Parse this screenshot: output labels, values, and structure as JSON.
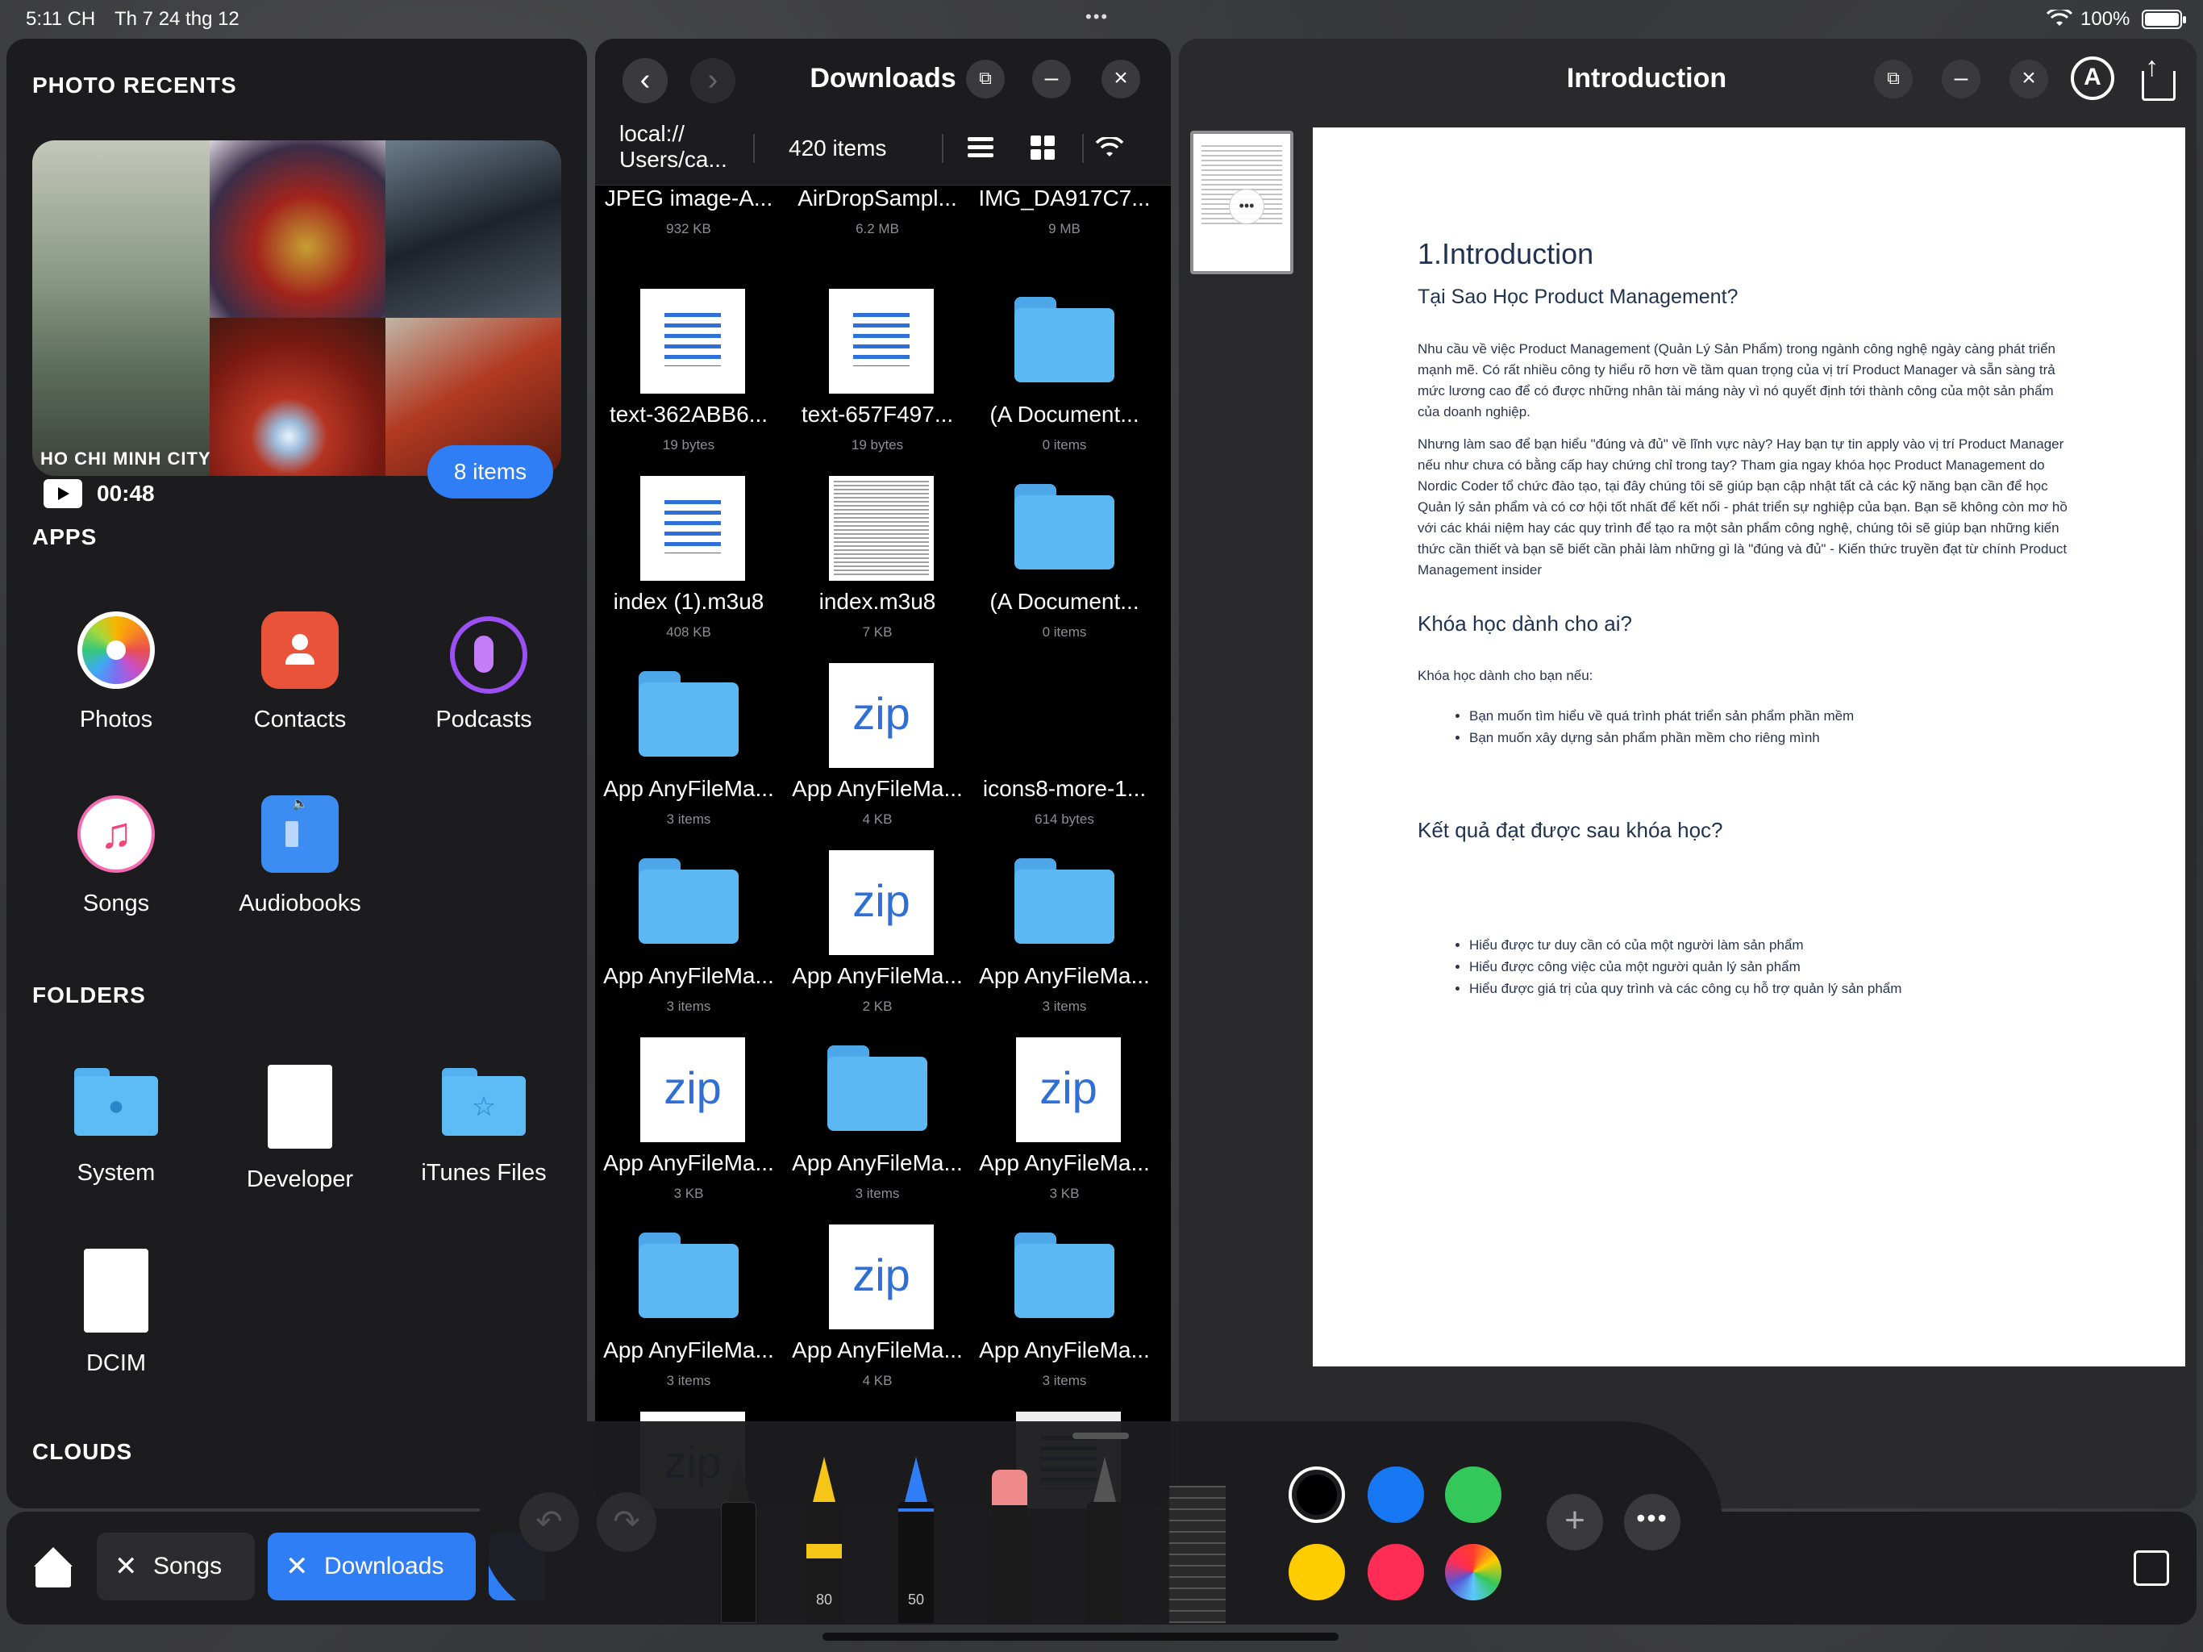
{
  "status_bar": {
    "time": "5:11 CH",
    "date": "Th 7 24 thg 12",
    "battery": "100%"
  },
  "left_panel": {
    "photo_recents_title": "PHOTO RECENTS",
    "photo_overlay_text": "HO CHI MINH CITY",
    "video_duration": "00:48",
    "photo_count": "8 items",
    "apps_title": "APPS",
    "apps": [
      {
        "label": "Photos",
        "icon": "photos-icon"
      },
      {
        "label": "Contacts",
        "icon": "contacts-icon"
      },
      {
        "label": "Podcasts",
        "icon": "podcasts-icon"
      },
      {
        "label": "Songs",
        "icon": "songs-icon"
      },
      {
        "label": "Audiobooks",
        "icon": "audiobooks-icon"
      }
    ],
    "folders_title": "FOLDERS",
    "folders": [
      {
        "label": "System",
        "icon": "apple-folder-icon"
      },
      {
        "label": "Developer",
        "icon": "document-icon"
      },
      {
        "label": "iTunes Files",
        "icon": "star-folder-icon"
      },
      {
        "label": "DCIM",
        "icon": "document-icon"
      }
    ],
    "clouds_title": "CLOUDS"
  },
  "downloads": {
    "title": "Downloads",
    "path": "local:// Users/ca...",
    "item_count": "420 items",
    "files": [
      {
        "name": "JPEG image-A...",
        "meta": "932 KB",
        "thumb": "none"
      },
      {
        "name": "AirDropSampl...",
        "meta": "6.2 MB",
        "thumb": "none"
      },
      {
        "name": "IMG_DA917C7...",
        "meta": "9 MB",
        "thumb": "none"
      },
      {
        "name": "text-362ABB6...",
        "meta": "19 bytes",
        "thumb": "text"
      },
      {
        "name": "text-657F497...",
        "meta": "19 bytes",
        "thumb": "text"
      },
      {
        "name": "(A Document...",
        "meta": "0 items",
        "thumb": "folder"
      },
      {
        "name": "index (1).m3u8",
        "meta": "408 KB",
        "thumb": "text"
      },
      {
        "name": "index.m3u8",
        "meta": "7 KB",
        "thumb": "doc"
      },
      {
        "name": "(A Document...",
        "meta": "0 items",
        "thumb": "folder"
      },
      {
        "name": "App AnyFileMa...",
        "meta": "3 items",
        "thumb": "folder"
      },
      {
        "name": "App AnyFileMa...",
        "meta": "4 KB",
        "thumb": "zip"
      },
      {
        "name": "icons8-more-1...",
        "meta": "614 bytes",
        "thumb": "none"
      },
      {
        "name": "App AnyFileMa...",
        "meta": "3 items",
        "thumb": "folder"
      },
      {
        "name": "App AnyFileMa...",
        "meta": "2 KB",
        "thumb": "zip"
      },
      {
        "name": "App AnyFileMa...",
        "meta": "3 items",
        "thumb": "folder"
      },
      {
        "name": "App AnyFileMa...",
        "meta": "3 KB",
        "thumb": "zip"
      },
      {
        "name": "App AnyFileMa...",
        "meta": "3 items",
        "thumb": "folder"
      },
      {
        "name": "App AnyFileMa...",
        "meta": "3 KB",
        "thumb": "zip"
      },
      {
        "name": "App AnyFileMa...",
        "meta": "3 items",
        "thumb": "folder"
      },
      {
        "name": "App AnyFileMa...",
        "meta": "4 KB",
        "thumb": "zip"
      },
      {
        "name": "App AnyFileMa...",
        "meta": "3 items",
        "thumb": "folder"
      }
    ],
    "zip_label": "zip"
  },
  "document": {
    "window_title": "Introduction",
    "heading": "1.Introduction",
    "subheading": "Tại Sao Học Product Management?",
    "para1": "Nhu cầu về việc Product Management (Quản Lý Sản Phẩm) trong ngành công nghệ ngày càng phát triển mạnh mẽ. Có rất nhiều công ty hiểu rõ hơn về tầm quan trọng của vị trí Product Manager và sẵn sàng trả mức lương cao để có được những nhân tài máng này vì nó quyết định tới thành công của một sản phẩm của doanh nghiệp.",
    "para2": "Nhưng làm sao để bạn hiểu \"đúng và đủ\" về lĩnh vực này? Hay bạn tự tin apply vào vị trí Product Manager nếu như chưa có bằng cấp hay chứng chỉ trong tay? Tham gia ngay khóa học Product Management do Nordic Coder tổ chức đào tạo, tại đây chúng tôi sẽ giúp bạn cập nhật tất cả các kỹ năng bạn cần để học Quản lý sản phẩm và có cơ hội tốt nhất để kết nối - phát triển sự nghiệp của bạn. Bạn sẽ không còn mơ hồ với các khái niệm hay các quy trình để tạo ra một sản phẩm công nghệ, chúng tôi sẽ giúp bạn những kiến thức cần thiết và bạn sẽ biết cần phải làm những gì là \"đúng và đủ\" - Kiến thức truyền đạt từ chính Product Management insider",
    "section1_title": "Khóa học dành cho ai?",
    "section1_intro": "Khóa học dành cho bạn nếu:",
    "section1_items": [
      "Bạn muốn tìm hiểu về quá trình phát triển sản phẩm phần mềm",
      "Bạn muốn xây dựng sản phẩm phần mềm cho riêng mình"
    ],
    "section2_title": "Kết quả đạt được sau khóa học?",
    "section2_items": [
      "Hiểu được tư duy cần có của một người làm sản phẩm",
      "Hiểu được công việc của một người quản lý sản phẩm",
      "Hiểu được giá trị của quy trình và các công cụ hỗ trợ quản lý sản phẩm"
    ]
  },
  "bottom_bar": {
    "tabs": [
      {
        "label": "Songs"
      },
      {
        "label": "Downloads"
      }
    ]
  },
  "markup_tools": {
    "marker_opacity": "80",
    "pencil_width": "50",
    "colors": [
      "#000000",
      "#1877f2",
      "#34c759",
      "#ffcc00",
      "#ff2d55",
      "multicolor"
    ]
  }
}
